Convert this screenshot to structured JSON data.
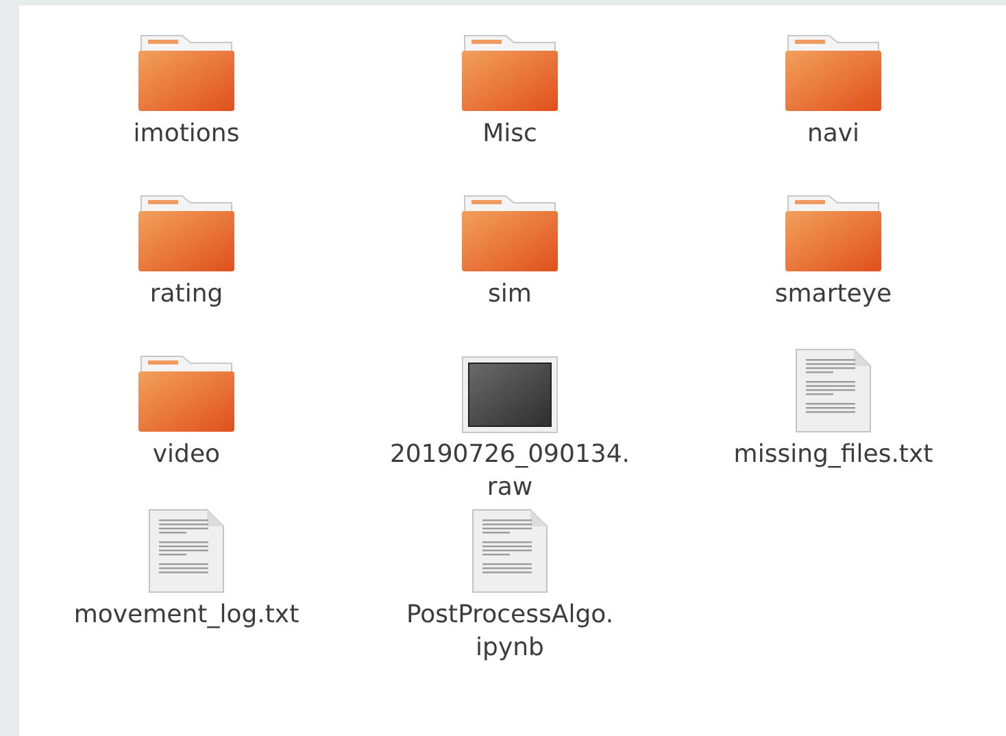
{
  "items": [
    {
      "kind": "folder",
      "name": [
        "imotions"
      ]
    },
    {
      "kind": "folder",
      "name": [
        "Misc"
      ]
    },
    {
      "kind": "folder",
      "name": [
        "navi"
      ]
    },
    {
      "kind": "folder",
      "name": [
        "rating"
      ]
    },
    {
      "kind": "folder",
      "name": [
        "sim"
      ]
    },
    {
      "kind": "folder",
      "name": [
        "smarteye"
      ]
    },
    {
      "kind": "folder",
      "name": [
        "video"
      ]
    },
    {
      "kind": "raw",
      "name": [
        "20190726_090134.",
        "raw"
      ]
    },
    {
      "kind": "text",
      "name": [
        "missing_files.txt"
      ]
    },
    {
      "kind": "text",
      "name": [
        "movement_log.txt"
      ]
    },
    {
      "kind": "text",
      "name": [
        "PostProcessAlgo.",
        "ipynb"
      ]
    }
  ]
}
